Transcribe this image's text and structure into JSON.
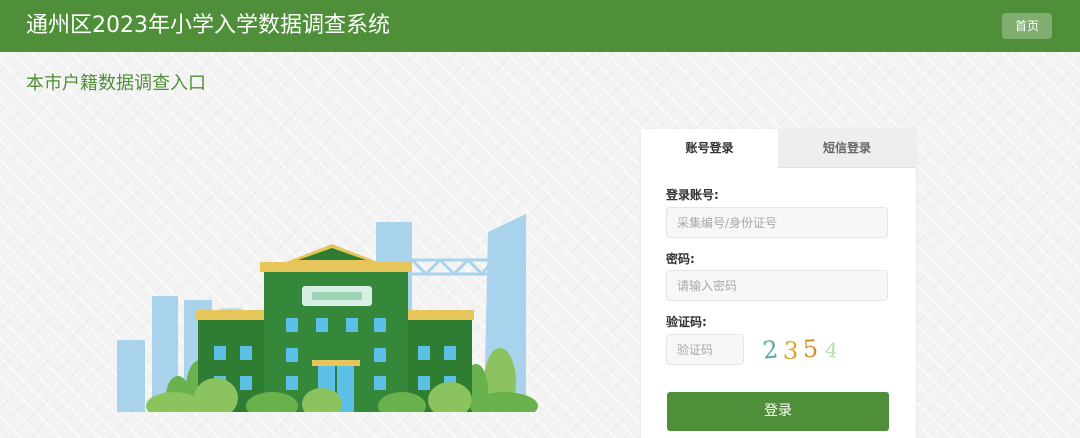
{
  "header": {
    "title": "通州区2023年小学入学数据调查系统",
    "home_label": "首页"
  },
  "subtitle": "本市户籍数据调查入口",
  "login": {
    "tabs": [
      {
        "label": "账号登录",
        "active": true
      },
      {
        "label": "短信登录",
        "active": false
      }
    ],
    "account_label": "登录账号:",
    "account_placeholder": "采集编号/身份证号",
    "password_label": "密码:",
    "password_placeholder": "请输入密码",
    "captcha_label": "验证码:",
    "captcha_placeholder": "验证码",
    "captcha_chars": [
      "2",
      "3",
      "5",
      "4"
    ],
    "submit_label": "登录"
  },
  "colors": {
    "brand_green": "#4f8f3a",
    "page_bg": "#f3f3f3"
  }
}
